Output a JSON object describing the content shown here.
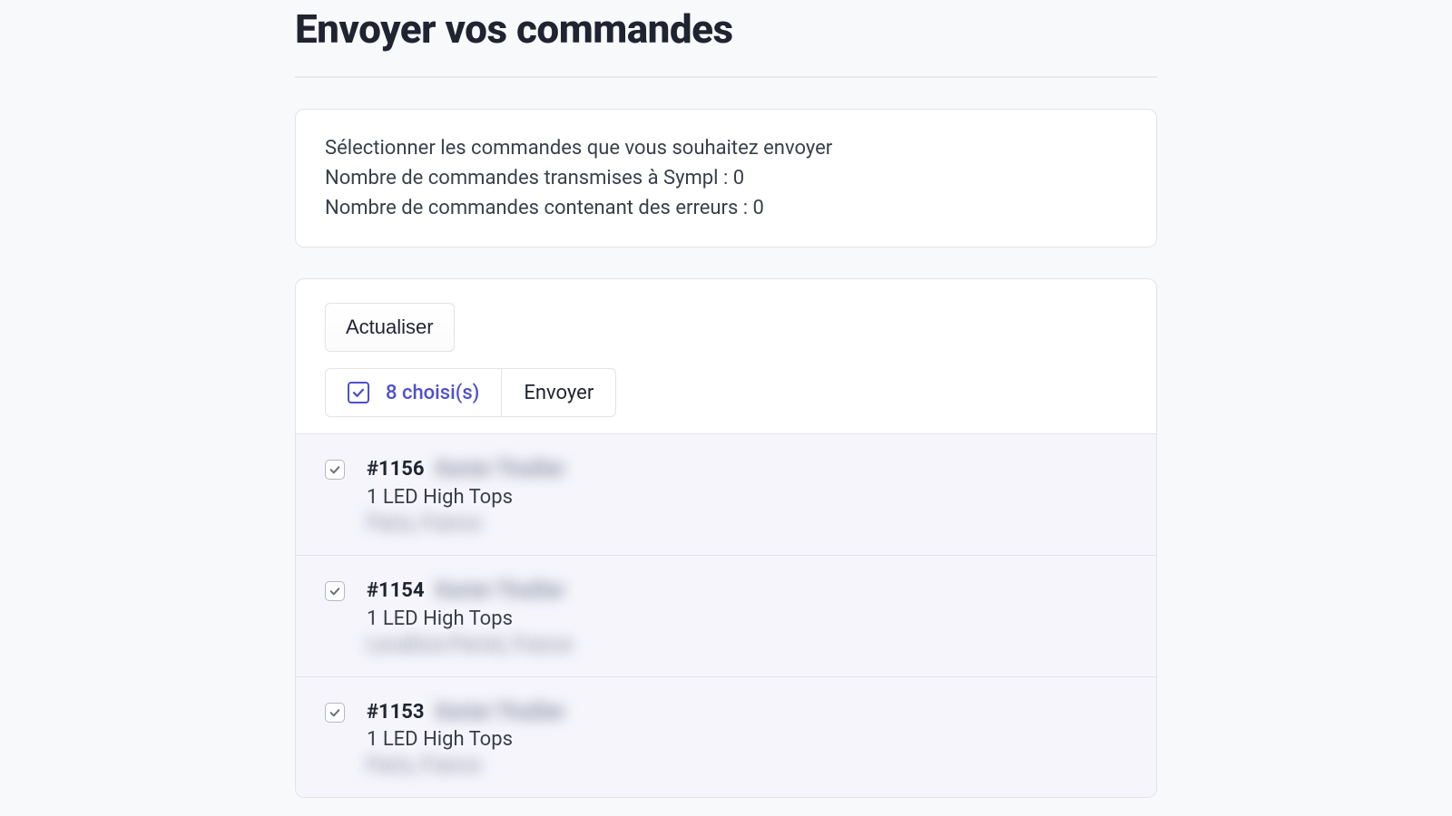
{
  "header": {
    "title": "Envoyer vos commandes"
  },
  "info": {
    "line1": "Sélectionner les commandes que vous souhaitez envoyer",
    "line2": "Nombre de commandes transmises à Sympl : 0",
    "line3": "Nombre de commandes contenant des erreurs : 0"
  },
  "toolbar": {
    "refresh_label": "Actualiser",
    "selected_count_label": "8 choisi(s)",
    "send_label": "Envoyer"
  },
  "orders": [
    {
      "id": "#1156",
      "customer_masked": "Xavier Thuilier",
      "summary": "1 LED High Tops",
      "location_masked": "Paris, France"
    },
    {
      "id": "#1154",
      "customer_masked": "Xavier Thuilier",
      "summary": "1 LED High Tops",
      "location_masked": "Levallois-Perret, France"
    },
    {
      "id": "#1153",
      "customer_masked": "Xavier Thuilier",
      "summary": "1 LED High Tops",
      "location_masked": "Paris, France"
    }
  ]
}
